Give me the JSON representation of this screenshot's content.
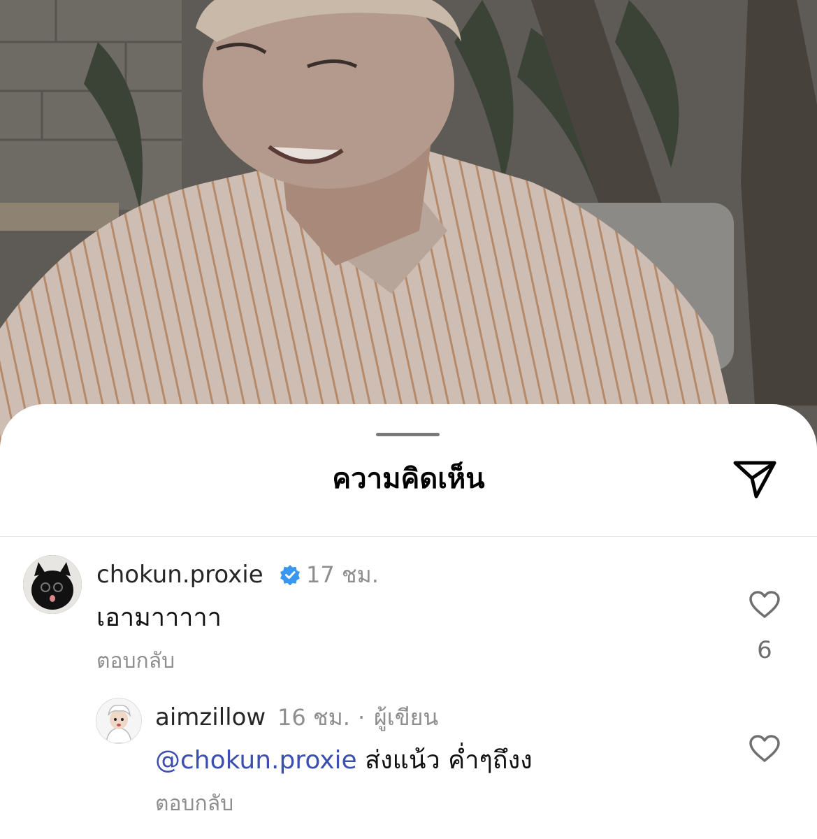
{
  "sheet": {
    "title": "ความคิดเห็น",
    "share_icon": "paper-plane-icon"
  },
  "comments": [
    {
      "username": "chokun.proxie",
      "verified": true,
      "time": "17 ชม.",
      "text": "เอามาาาาา",
      "reply_label": "ตอบกลับ",
      "likes": "6",
      "avatar_icon": "black-cat-avatar"
    }
  ],
  "replies": [
    {
      "username": "aimzillow",
      "time": "16 ชม.",
      "separator": "·",
      "author_badge": "ผู้เขียน",
      "mention": "@chokun.proxie",
      "text": " ส่งแน้ว ค่ำๆถึงง",
      "reply_label": "ตอบกลับ",
      "avatar_icon": "cartoon-white-hair-avatar"
    }
  ],
  "colors": {
    "mention": "#3c4fb0",
    "verified": "#3897f0",
    "muted": "#8e8e8e"
  }
}
